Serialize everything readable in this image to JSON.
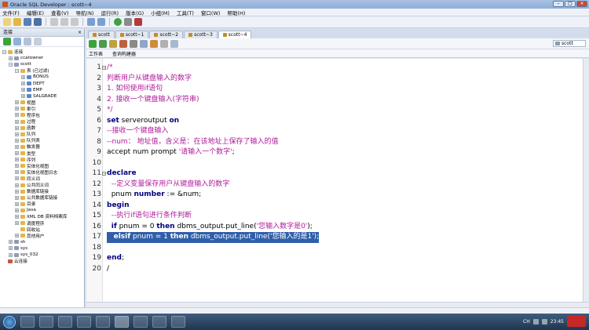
{
  "window": {
    "title": "Oracle SQL Developer : scott~4"
  },
  "menu": [
    "文件(F)",
    "编辑(E)",
    "查看(V)",
    "导航(N)",
    "运行(R)",
    "版本(G)",
    "小组(M)",
    "工具(T)",
    "窗口(W)",
    "帮助(H)"
  ],
  "left_panel": {
    "title": "连接",
    "tree": [
      {
        "label": "连接",
        "level": 0,
        "exp": "−",
        "icon": "folder"
      },
      {
        "label": "ccatowner",
        "level": 1,
        "exp": "+",
        "icon": "db"
      },
      {
        "label": "scott",
        "level": 1,
        "exp": "−",
        "icon": "db"
      },
      {
        "label": "表 (已过滤)",
        "level": 2,
        "exp": "−",
        "icon": "folder"
      },
      {
        "label": "BONUS",
        "level": 3,
        "exp": "+",
        "icon": "table"
      },
      {
        "label": "DEPT",
        "level": 3,
        "exp": "+",
        "icon": "table"
      },
      {
        "label": "EMP",
        "level": 3,
        "exp": "+",
        "icon": "table"
      },
      {
        "label": "SALGRADE",
        "level": 3,
        "exp": "+",
        "icon": "table"
      },
      {
        "label": "视图",
        "level": 2,
        "exp": "+",
        "icon": "folder"
      },
      {
        "label": "索引",
        "level": 2,
        "exp": "+",
        "icon": "folder"
      },
      {
        "label": "程序包",
        "level": 2,
        "exp": "+",
        "icon": "folder"
      },
      {
        "label": "过程",
        "level": 2,
        "exp": "+",
        "icon": "folder"
      },
      {
        "label": "函数",
        "level": 2,
        "exp": "+",
        "icon": "folder"
      },
      {
        "label": "队列",
        "level": 2,
        "exp": "+",
        "icon": "folder"
      },
      {
        "label": "队列表",
        "level": 2,
        "exp": "+",
        "icon": "folder"
      },
      {
        "label": "触发器",
        "level": 2,
        "exp": "+",
        "icon": "folder"
      },
      {
        "label": "类型",
        "level": 2,
        "exp": "+",
        "icon": "folder"
      },
      {
        "label": "序列",
        "level": 2,
        "exp": "+",
        "icon": "folder"
      },
      {
        "label": "实体化视图",
        "level": 2,
        "exp": "+",
        "icon": "folder"
      },
      {
        "label": "实体化视图日志",
        "level": 2,
        "exp": "+",
        "icon": "folder"
      },
      {
        "label": "同义词",
        "level": 2,
        "exp": "+",
        "icon": "folder"
      },
      {
        "label": "公共同义词",
        "level": 2,
        "exp": "+",
        "icon": "folder"
      },
      {
        "label": "数据库链接",
        "level": 2,
        "exp": "+",
        "icon": "folder"
      },
      {
        "label": "公共数据库链接",
        "level": 2,
        "exp": "+",
        "icon": "folder"
      },
      {
        "label": "目录",
        "level": 2,
        "exp": "+",
        "icon": "folder"
      },
      {
        "label": "Java",
        "level": 2,
        "exp": "+",
        "icon": "folder"
      },
      {
        "label": "XML DB 资料档案库",
        "level": 2,
        "exp": "+",
        "icon": "folder"
      },
      {
        "label": "调度程序",
        "level": 2,
        "exp": "+",
        "icon": "folder"
      },
      {
        "label": "回收站",
        "level": 2,
        "exp": "",
        "icon": "folder"
      },
      {
        "label": "其他用户",
        "level": 2,
        "exp": "+",
        "icon": "folder"
      },
      {
        "label": "sh",
        "level": 1,
        "exp": "+",
        "icon": "db"
      },
      {
        "label": "sys",
        "level": 1,
        "exp": "+",
        "icon": "db"
      },
      {
        "label": "sys_032",
        "level": 1,
        "exp": "+",
        "icon": "db"
      },
      {
        "label": "云连接",
        "level": 0,
        "exp": "",
        "icon": "conn"
      }
    ]
  },
  "doc_tabs": [
    "scott",
    "scott~1",
    "scott~2",
    "scott~3",
    "scott~4"
  ],
  "connection_select": "scott",
  "sub_tabs": [
    "工作表",
    "查询构建器"
  ],
  "editor": {
    "lines": [
      {
        "n": "1",
        "parts": [
          [
            "cm",
            "/*"
          ]
        ]
      },
      {
        "n": "2",
        "parts": [
          [
            "cm",
            "判断用户从键盘输入的数字"
          ]
        ]
      },
      {
        "n": "3",
        "parts": [
          [
            "cm",
            "1. 如何使用if语句"
          ]
        ]
      },
      {
        "n": "4",
        "parts": [
          [
            "cm",
            "2. 接收一个键盘输入(字符串)"
          ]
        ]
      },
      {
        "n": "5",
        "parts": [
          [
            "cm",
            "*/"
          ]
        ]
      },
      {
        "n": "6",
        "parts": [
          [
            "kw",
            "set"
          ],
          [
            "tx",
            " serveroutput "
          ],
          [
            "kw",
            "on"
          ]
        ]
      },
      {
        "n": "7",
        "parts": [
          [
            "cm",
            "--接收一个键盘输入"
          ]
        ]
      },
      {
        "n": "8",
        "parts": [
          [
            "cm",
            "--num： 地址值，含义是：在该地址上保存了输入的值"
          ]
        ]
      },
      {
        "n": "9",
        "parts": [
          [
            "tx",
            "accept num prompt "
          ],
          [
            "str",
            "'请输入一个数字'"
          ],
          [
            "tx",
            ";"
          ]
        ]
      },
      {
        "n": "10",
        "parts": []
      },
      {
        "n": "11",
        "parts": [
          [
            "kw",
            "declare"
          ]
        ]
      },
      {
        "n": "12",
        "parts": [
          [
            "cm",
            "  --定义变量保存用户从键盘输入的数字"
          ]
        ]
      },
      {
        "n": "13",
        "parts": [
          [
            "tx",
            "  pnum "
          ],
          [
            "kw",
            "number"
          ],
          [
            "tx",
            " := &num;"
          ]
        ]
      },
      {
        "n": "14",
        "parts": [
          [
            "kw",
            "begin"
          ]
        ]
      },
      {
        "n": "15",
        "parts": [
          [
            "cm",
            "  --执行if语句进行条件判断"
          ]
        ]
      },
      {
        "n": "16",
        "parts": [
          [
            "tx",
            "  "
          ],
          [
            "kw",
            "if"
          ],
          [
            "tx",
            " pnum = 0 "
          ],
          [
            "kw",
            "then"
          ],
          [
            "tx",
            " dbms_output.put_line("
          ],
          [
            "str",
            "'您输入数字是0'"
          ],
          [
            "tx",
            ");"
          ]
        ]
      },
      {
        "n": "17",
        "selected": true,
        "parts": [
          [
            "tx",
            "   "
          ],
          [
            "kw",
            "elsif"
          ],
          [
            "tx",
            " pnum = 1 "
          ],
          [
            "kw",
            "then"
          ],
          [
            "tx",
            " dbms_output.put_line("
          ],
          [
            "str",
            "'您输入的是1'"
          ],
          [
            "tx",
            ");"
          ]
        ]
      },
      {
        "n": "18",
        "parts": []
      },
      {
        "n": "19",
        "parts": [
          [
            "kw",
            "end"
          ],
          [
            "tx",
            ";"
          ]
        ]
      },
      {
        "n": "20",
        "parts": [
          [
            "tx",
            "/"
          ]
        ]
      }
    ]
  },
  "taskbar": {
    "ime": "CH",
    "clock": "23:45"
  },
  "colors": {
    "comment": "#b01a9b",
    "keyword": "#000080",
    "selection": "#2f5fa8"
  }
}
